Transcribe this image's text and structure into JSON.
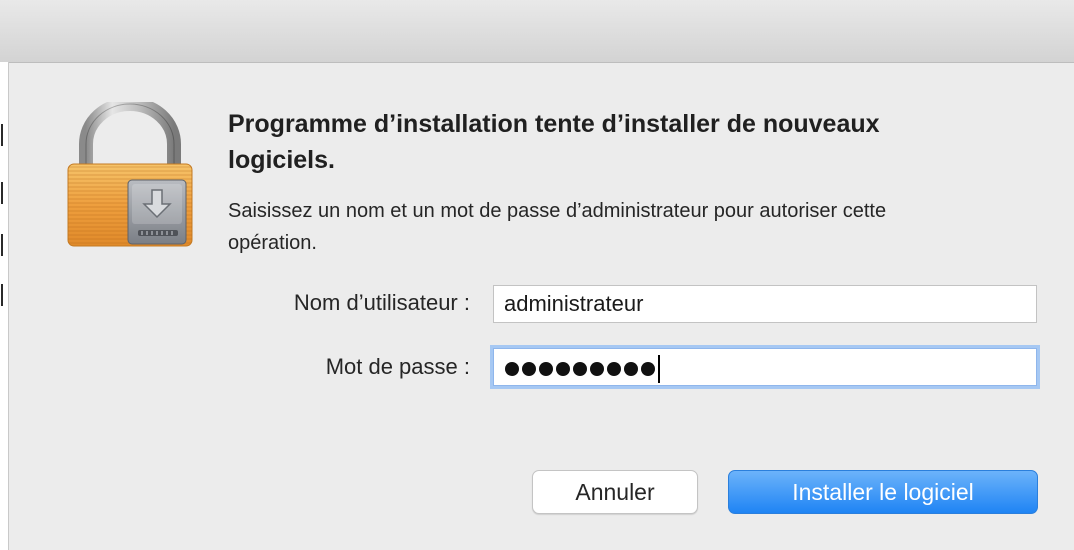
{
  "dialog": {
    "title": "Programme d’installation tente d’installer de nouveaux logiciels.",
    "message": "Saisissez un nom et un mot de passe d’administrateur pour autoriser cette opération.",
    "icon": "lock-installer-icon"
  },
  "form": {
    "username_label": "Nom d’utilisateur :",
    "username_value": "administrateur",
    "password_label": "Mot de passe :",
    "password_dot_count": 9
  },
  "buttons": {
    "cancel_label": "Annuler",
    "install_label": "Installer le logiciel"
  },
  "colors": {
    "accent": "#1f84f4",
    "lock_body": "#f0a84a",
    "focus_ring": "#a6c8f3"
  }
}
